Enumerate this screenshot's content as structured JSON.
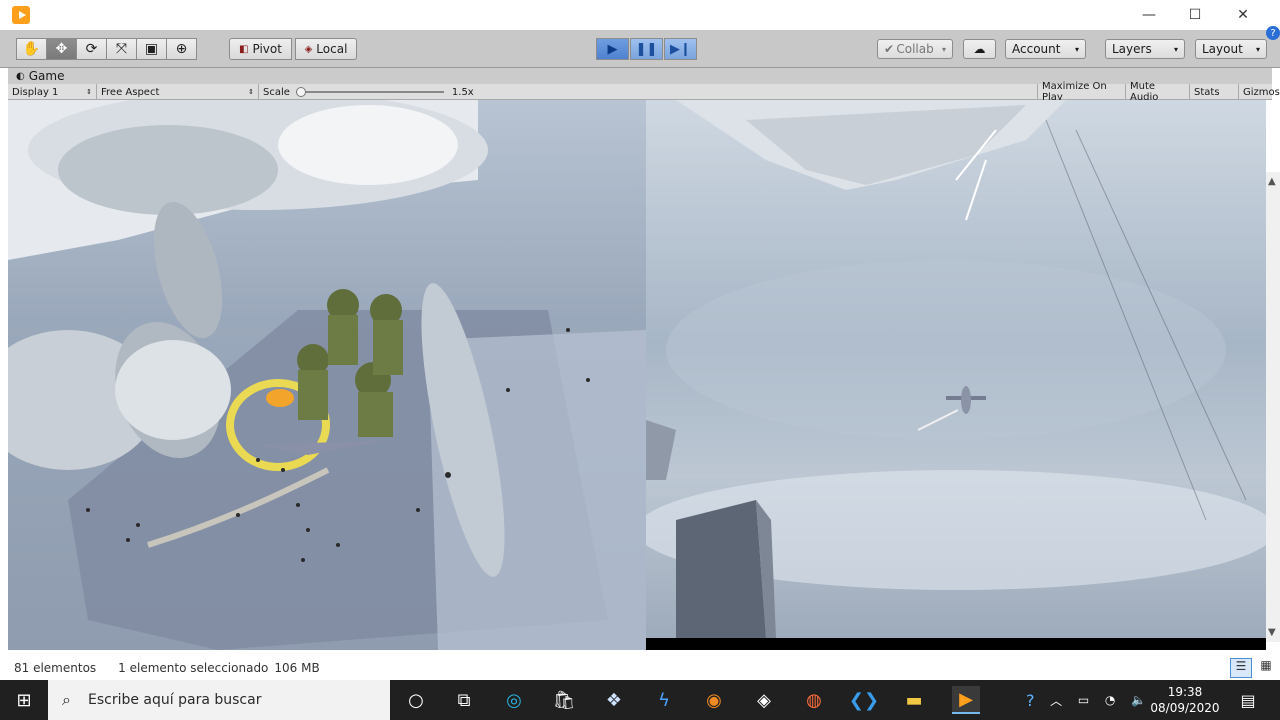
{
  "window": {
    "minimize": "—",
    "maximize": "☐",
    "close": "✕"
  },
  "toolbar": {
    "pivot_label": "Pivot",
    "local_label": "Local",
    "collab_label": "Collab",
    "account_label": "Account",
    "layers_label": "Layers",
    "layout_label": "Layout"
  },
  "game_view": {
    "tab_label": "Game",
    "display": "Display 1",
    "aspect": "Free Aspect",
    "scale_label": "Scale",
    "scale_value": "1.5x",
    "maximize_on_play": "Maximize On Play",
    "mute_audio": "Mute Audio",
    "stats": "Stats",
    "gizmos": "Gizmos"
  },
  "status_bar": {
    "count": "81 elementos",
    "selection": "1 elemento seleccionado",
    "size": "106 MB"
  },
  "taskbar": {
    "search_placeholder": "Escribe aquí para buscar",
    "time": "19:38",
    "date": "08/09/2020"
  },
  "colors": {
    "accent": "#ff9f1c",
    "toolbar_bg": "#c8c8c8",
    "play_active": "#4f82cf",
    "taskbar_bg": "#202020"
  }
}
